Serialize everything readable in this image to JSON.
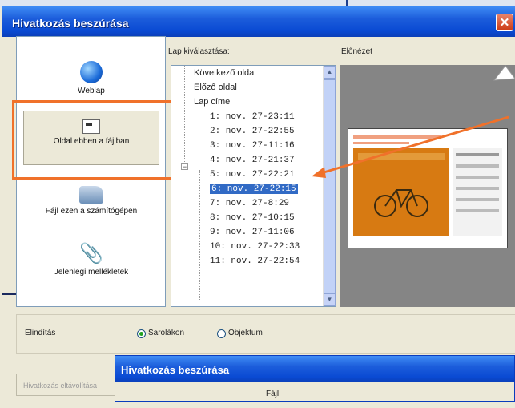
{
  "window": {
    "title": "Hivatkozás beszúrása",
    "close": "✕"
  },
  "nav": {
    "items": [
      {
        "label": "Weblap",
        "icon": "globe-icon"
      },
      {
        "label": "Oldal ebben a fájlban",
        "icon": "page-icon"
      },
      {
        "label": "Fájl ezen a számítógépen",
        "icon": "folder-icon"
      },
      {
        "label": "Jelenlegi mellékletek",
        "icon": "paperclip-icon"
      }
    ]
  },
  "tree": {
    "header": "Lap kiválasztása:",
    "items": [
      "Következő oldal",
      "Előző oldal",
      "Lap címe",
      "1: nov. 27-23:11",
      "2: nov. 27-22:55",
      "3: nov. 27-11:16",
      "4: nov. 27-21:37",
      "5: nov. 27-22:21",
      "6: nov. 27-22:15",
      "7: nov. 27-8:29",
      "8: nov. 27-10:15",
      "9: nov. 27-11:06",
      "10: nov. 27-22:33",
      "11: nov. 27-22:54"
    ],
    "selected_index": 8
  },
  "preview": {
    "header": "Előnézet"
  },
  "start": {
    "label": "Elindítás",
    "options": [
      "Sarolákon",
      "Objektum"
    ],
    "selected": "Sarolákon"
  },
  "bottom": {
    "faded_label": "Hivatkozás eltávolítása"
  },
  "subwindow": {
    "title": "Hivatkozás beszúrása",
    "label": "Fájl"
  }
}
